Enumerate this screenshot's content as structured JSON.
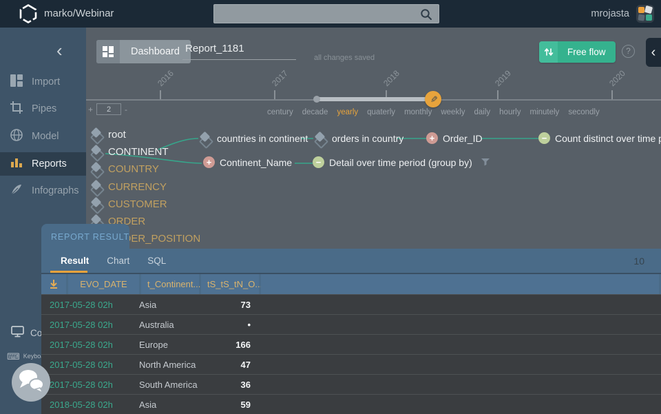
{
  "topbar": {
    "app_title": "marko/Webinar",
    "search_value": "",
    "username": "mrojasta"
  },
  "sidebar": {
    "items": [
      {
        "label": "Import",
        "icon": "grid-icon",
        "active": false
      },
      {
        "label": "Pipes",
        "icon": "crop-icon",
        "active": false
      },
      {
        "label": "Model",
        "icon": "globe-icon",
        "active": false
      },
      {
        "label": "Reports",
        "icon": "bar-chart-icon",
        "active": true
      },
      {
        "label": "Infographs",
        "icon": "feather-icon",
        "active": false
      }
    ],
    "console_label": "Cor",
    "keyboard_label": "Keyboar"
  },
  "toolbar": {
    "dashboard_label": "Dashboard",
    "report_title": "Report_1181",
    "save_status": "all changes saved",
    "free_flow_label": "Free flow"
  },
  "timeline": {
    "years": [
      "2016",
      "2017",
      "2018",
      "2019",
      "2020"
    ],
    "zoom_plus": "+",
    "zoom_minus": "-",
    "zoom_value": "2",
    "granularities": [
      "century",
      "decade",
      "yearly",
      "quaterly",
      "monthly",
      "weekly",
      "daily",
      "hourly",
      "minutely",
      "secondly"
    ],
    "active_granularity": "yearly"
  },
  "model_tree": {
    "entities": [
      "root",
      "CONTINENT",
      "COUNTRY",
      "CURRENCY",
      "CUSTOMER",
      "ORDER",
      "ORDER_POSITION"
    ],
    "nodes": {
      "countries_in_continent": "countries in continent",
      "orders_in_country": "orders in country",
      "order_id": "Order_ID",
      "count_distinct": "Count distinct over time pe",
      "continent_name": "Continent_Name",
      "detail_over_time": "Detail over time period (group by)"
    }
  },
  "report_panel": {
    "title": "REPORT RESULT",
    "tabs": [
      "Result",
      "Chart",
      "SQL"
    ],
    "active_tab": "Result",
    "row_count": "10",
    "columns": [
      "EVO_DATE",
      "t_Continent...",
      "tS_tS_tN_O..."
    ],
    "rows": [
      {
        "date": "2017-05-28 02h",
        "continent": "Asia",
        "value": "73"
      },
      {
        "date": "2017-05-28 02h",
        "continent": "Australia",
        "value": "•"
      },
      {
        "date": "2017-05-28 02h",
        "continent": "Europe",
        "value": "166"
      },
      {
        "date": "2017-05-28 02h",
        "continent": "North America",
        "value": "47"
      },
      {
        "date": "2017-05-28 02h",
        "continent": "South America",
        "value": "36"
      },
      {
        "date": "2018-05-28 02h",
        "continent": "Asia",
        "value": "59"
      }
    ]
  },
  "colors": {
    "topbar_bg": "#1b2936",
    "sidebar_bg": "#3e5468",
    "main_bg": "#575f67",
    "panel_bg": "#4a6b88",
    "accent_teal": "#35b28e",
    "accent_orange": "#e7a33c",
    "link_teal": "#36a68b",
    "entity_gold": "#c1a060",
    "date_teal": "#3aa98d"
  }
}
